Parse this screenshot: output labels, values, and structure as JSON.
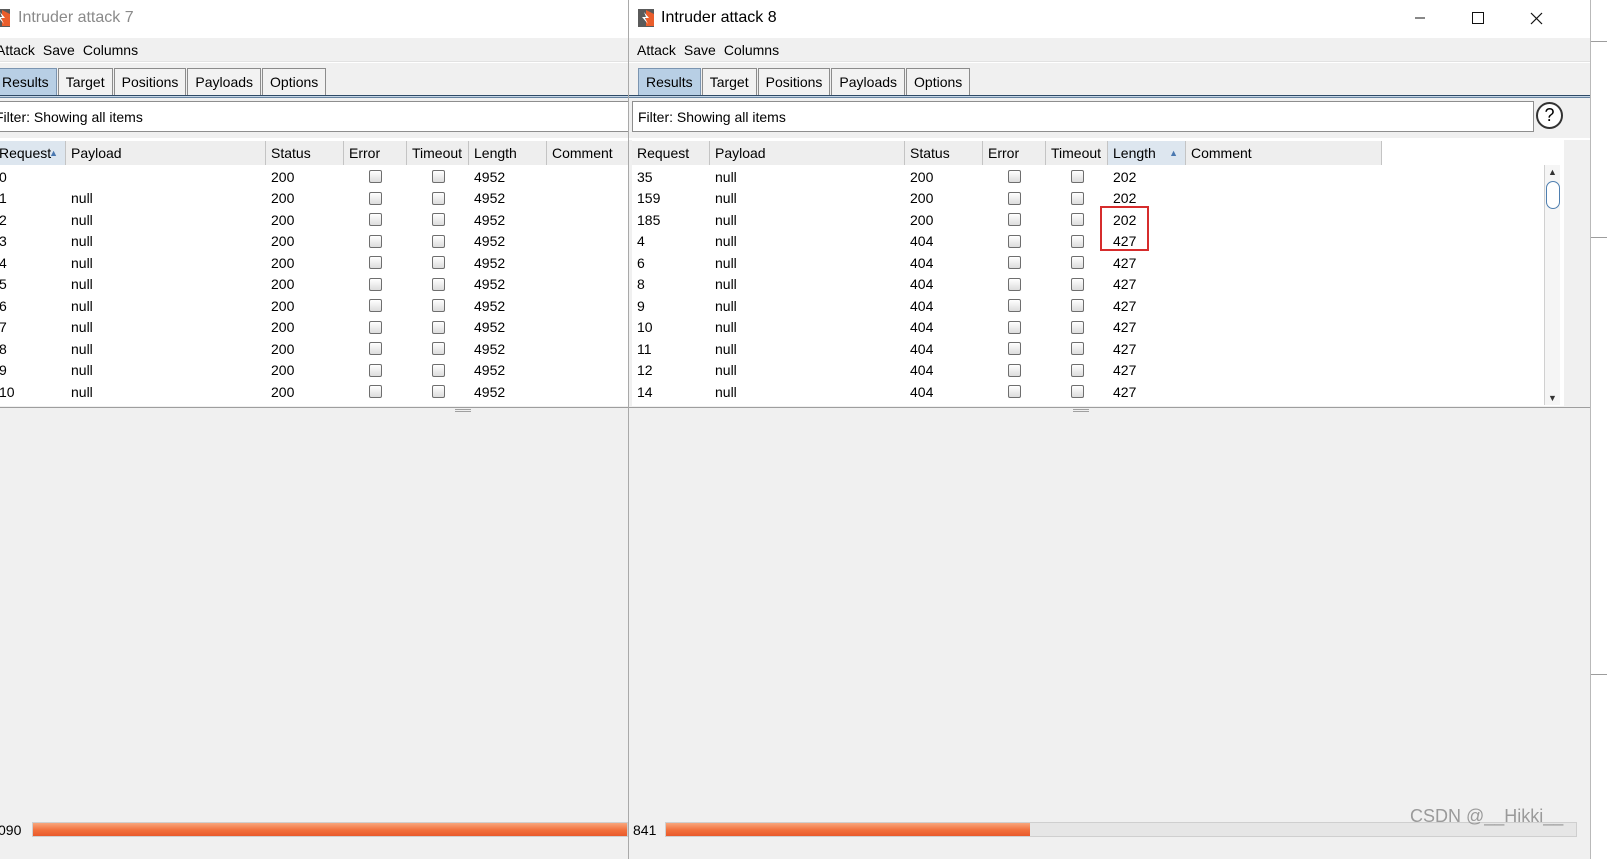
{
  "colors": {
    "accent_orange": "#ea5e2c",
    "active_tab": "#b8cfe5",
    "highlight_box": "#d62c2c"
  },
  "left_window": {
    "title": "Intruder attack 7",
    "menu": [
      "Attack",
      "Save",
      "Columns"
    ],
    "tabs": [
      "Results",
      "Target",
      "Positions",
      "Payloads",
      "Options"
    ],
    "active_tab": "Results",
    "filter_text": "Filter: Showing all items",
    "columns": [
      "Request",
      "Payload",
      "Status",
      "Error",
      "Timeout",
      "Length",
      "Comment"
    ],
    "sorted_column": "Request",
    "rows": [
      {
        "request": "0",
        "payload": "",
        "status": "200",
        "length": "4952"
      },
      {
        "request": "1",
        "payload": "null",
        "status": "200",
        "length": "4952"
      },
      {
        "request": "2",
        "payload": "null",
        "status": "200",
        "length": "4952"
      },
      {
        "request": "3",
        "payload": "null",
        "status": "200",
        "length": "4952"
      },
      {
        "request": "4",
        "payload": "null",
        "status": "200",
        "length": "4952"
      },
      {
        "request": "5",
        "payload": "null",
        "status": "200",
        "length": "4952"
      },
      {
        "request": "6",
        "payload": "null",
        "status": "200",
        "length": "4952"
      },
      {
        "request": "7",
        "payload": "null",
        "status": "200",
        "length": "4952"
      },
      {
        "request": "8",
        "payload": "null",
        "status": "200",
        "length": "4952"
      },
      {
        "request": "9",
        "payload": "null",
        "status": "200",
        "length": "4952"
      },
      {
        "request": "10",
        "payload": "null",
        "status": "200",
        "length": "4952"
      }
    ],
    "count_text": "090",
    "progress_fraction": 1.0
  },
  "right_window": {
    "title": "Intruder attack 8",
    "window_controls": [
      "minimize-icon",
      "maximize-icon",
      "close-icon"
    ],
    "menu": [
      "Attack",
      "Save",
      "Columns"
    ],
    "tabs": [
      "Results",
      "Target",
      "Positions",
      "Payloads",
      "Options"
    ],
    "active_tab": "Results",
    "filter_text": "Filter: Showing all items",
    "help_label": "?",
    "columns": [
      "Request",
      "Payload",
      "Status",
      "Error",
      "Timeout",
      "Length",
      "Comment"
    ],
    "sorted_column": "Length",
    "rows": [
      {
        "request": "35",
        "payload": "null",
        "status": "200",
        "length": "202"
      },
      {
        "request": "159",
        "payload": "null",
        "status": "200",
        "length": "202"
      },
      {
        "request": "185",
        "payload": "null",
        "status": "200",
        "length": "202"
      },
      {
        "request": "4",
        "payload": "null",
        "status": "404",
        "length": "427"
      },
      {
        "request": "6",
        "payload": "null",
        "status": "404",
        "length": "427"
      },
      {
        "request": "8",
        "payload": "null",
        "status": "404",
        "length": "427"
      },
      {
        "request": "9",
        "payload": "null",
        "status": "404",
        "length": "427"
      },
      {
        "request": "10",
        "payload": "null",
        "status": "404",
        "length": "427"
      },
      {
        "request": "11",
        "payload": "null",
        "status": "404",
        "length": "427"
      },
      {
        "request": "12",
        "payload": "null",
        "status": "404",
        "length": "427"
      },
      {
        "request": "14",
        "payload": "null",
        "status": "404",
        "length": "427"
      }
    ],
    "highlighted_rows": [
      2,
      3
    ],
    "count_text": "841",
    "progress_fraction": 0.4
  },
  "watermark": "CSDN @__Hikki__"
}
